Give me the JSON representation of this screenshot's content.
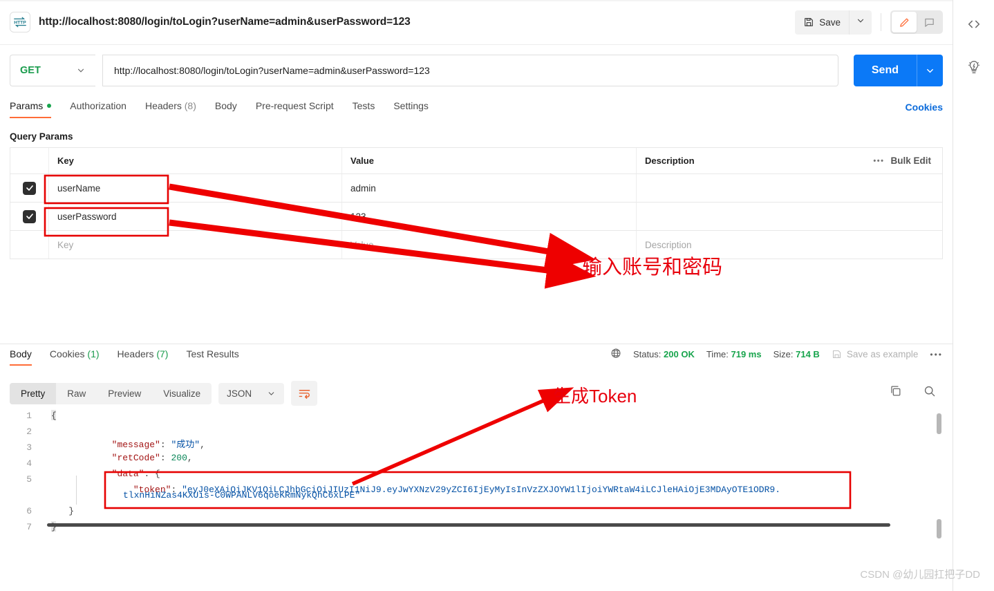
{
  "topbar": {
    "request_title": "http://localhost:8080/login/toLogin?userName=admin&userPassword=123",
    "http_badge": "HTTP",
    "save_label": "Save",
    "save_icon": "floppy-disk-icon",
    "save_caret_icon": "chevron-down-icon",
    "edit_icon": "pencil-icon",
    "comment_icon": "comment-icon"
  },
  "right_rail": {
    "code_icon": "code-brackets-icon",
    "bulb_icon": "lightbulb-bolt-icon"
  },
  "url_row": {
    "method": "GET",
    "method_caret_icon": "chevron-down-icon",
    "url": "http://localhost:8080/login/toLogin?userName=admin&userPassword=123",
    "send_label": "Send",
    "send_caret_icon": "chevron-down-icon"
  },
  "request_tabs": [
    {
      "label": "Params",
      "badge_dot": true,
      "active": true
    },
    {
      "label": "Authorization",
      "active": false
    },
    {
      "label": "Headers",
      "count": "(8)",
      "active": false
    },
    {
      "label": "Body",
      "active": false
    },
    {
      "label": "Pre-request Script",
      "active": false
    },
    {
      "label": "Tests",
      "active": false
    },
    {
      "label": "Settings",
      "active": false
    }
  ],
  "cookies_link": "Cookies",
  "query_params": {
    "section_title": "Query Params",
    "columns": [
      "Key",
      "Value",
      "Description"
    ],
    "bulk_edit_label": "Bulk Edit",
    "bulk_dots_icon": "ellipsis-icon",
    "rows": [
      {
        "checked": true,
        "key": "userName",
        "value": "admin",
        "description": ""
      },
      {
        "checked": true,
        "key": "userPassword",
        "value": "123",
        "description": ""
      }
    ],
    "placeholder_row": {
      "key": "Key",
      "value": "Value",
      "description": "Description"
    }
  },
  "response_tabs": [
    {
      "label": "Body",
      "active": true
    },
    {
      "label": "Cookies",
      "count": "(1)",
      "active": false
    },
    {
      "label": "Headers",
      "count": "(7)",
      "active": false
    },
    {
      "label": "Test Results",
      "active": false
    }
  ],
  "response_meta": {
    "globe_icon": "globe-icon",
    "status_label": "Status:",
    "status_value": "200 OK",
    "time_label": "Time:",
    "time_value": "719 ms",
    "size_label": "Size:",
    "size_value": "714 B",
    "save_example_label": "Save as example",
    "save_example_icon": "floppy-disk-icon",
    "more_icon": "ellipsis-icon"
  },
  "body_toolbar": {
    "views": [
      "Pretty",
      "Raw",
      "Preview",
      "Visualize"
    ],
    "active_view": "Pretty",
    "format": "JSON",
    "format_caret_icon": "chevron-down-icon",
    "wrap_icon": "word-wrap-icon",
    "copy_icon": "copy-icon",
    "search_icon": "search-icon"
  },
  "response_body": {
    "line_numbers": [
      "1",
      "2",
      "3",
      "4",
      "5",
      "6",
      "7"
    ],
    "json": {
      "message": "成功",
      "retCode": 200,
      "data": {
        "token": "eyJ0eXAiOiJKV1QiLCJhbGciOiJIUzI1NiJ9.eyJwYXNzV29yZCI6IjEyMyIsInVzZXJOYW1lIjoiYWRtaW4iLCJleHAiOjE3MDAyOTE1ODR9.tlxnHiNZas4KXUis-C0WPANLV6qoeKRmNykQhC6xLPE"
      }
    },
    "rendered_lines": [
      "{",
      "    \"message\": \"成功\",",
      "    \"retCode\": 200,",
      "    \"data\": {",
      "        \"token\": \"eyJ0eXAiOiJKV1QiLCJhbGciOiJIUzI1NiJ9.eyJwYXNzV29yZCI6IjEyMyIsInVzZXJOYW1lIjoiYWRtaW4iLCJleHAiOjE3MDAyOTE1ODR9.",
      "            tlxnHiNZas4KXUis-C0WPANLV6qoeKRmNykQhC6xLPE\"",
      "    }",
      "}"
    ],
    "token_line_1": "\"token\": \"eyJ0eXAiOiJKV1QiLCJhbGciOiJIUzI1NiJ9.eyJwYXNzV29yZCI6IjEyMyIsInVzZXJOYW1lIjoiYWRtaW4iLCJleHAiOjE3MDAyOTE1ODR9.",
    "token_line_2": "tlxnHiNZas4KXUis-C0WPANLV6qoeKRmNykQhC6xLPE\""
  },
  "annotations": {
    "params_note": "输入账号和密码",
    "token_note": "生成Token",
    "color": "#e8000d"
  },
  "watermark": "CSDN @幼儿园扛把子DD",
  "colors": {
    "accent": "#ff6c37",
    "send_blue": "#0b79f7",
    "link_blue": "#0b6bdb",
    "green": "#17a44c",
    "annotation_red": "#e8000d"
  }
}
